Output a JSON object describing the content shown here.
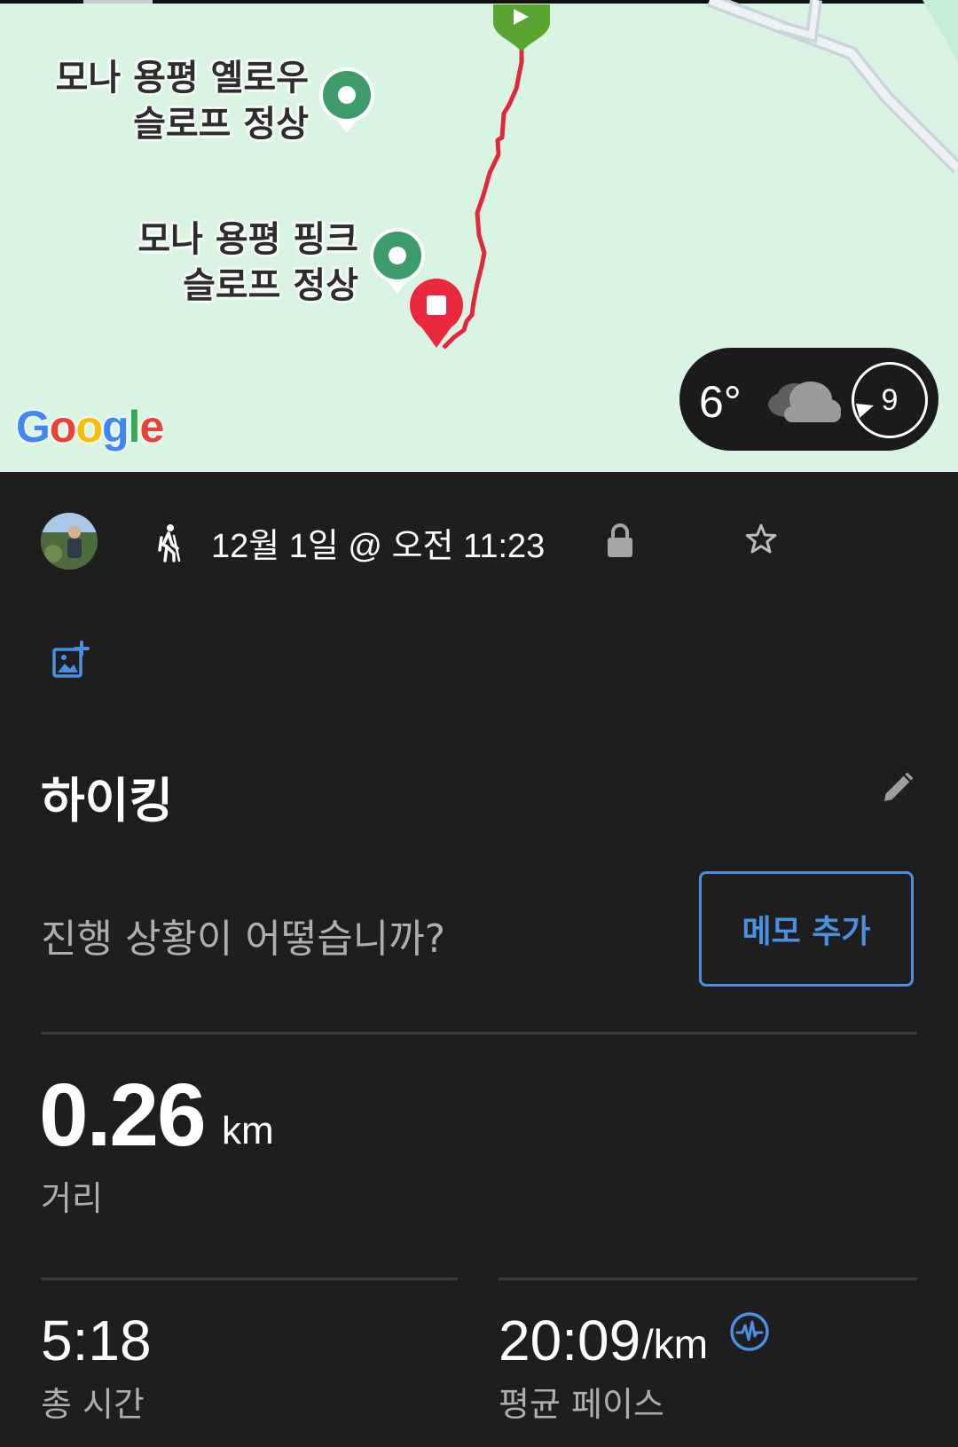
{
  "map": {
    "poi_1": {
      "line1": "모나 용평 옐로우",
      "line2": "슬로프 정상"
    },
    "poi_2": {
      "line1": "모나 용평 핑크",
      "line2": "슬로프 정상"
    },
    "logo_letters": [
      "G",
      "o",
      "o",
      "g",
      "l",
      "e"
    ],
    "logo_colors": [
      "#4285F4",
      "#EA4335",
      "#FBBC05",
      "#4285F4",
      "#34A853",
      "#EA4335"
    ],
    "route_color": "#e0283a",
    "start_color": "#5aa532",
    "end_color": "#e8283c",
    "poi_color": "#3e9c6b"
  },
  "weather": {
    "temperature": "6°",
    "icon": "cloud-icon",
    "wind_speed": "9",
    "wind_icon": "wind-direction-icon"
  },
  "activity": {
    "date_time": "12월 1일 @ 오전 11:23",
    "type_icon": "hiking-icon",
    "privacy_icon": "lock-icon",
    "favorite_icon": "star-icon",
    "photo_icon": "add-photo-icon",
    "title": "하이킹",
    "notes_prompt": "진행 상황이 어떻습니까?",
    "add_note_label": "메모 추가"
  },
  "stats": {
    "distance": {
      "value": "0.26",
      "unit": "km",
      "label": "거리"
    },
    "total_time": {
      "value": "5:18",
      "label": "총 시간"
    },
    "avg_pace": {
      "value": "20:09",
      "unit": "/km",
      "label": "평균 페이스"
    }
  },
  "colors": {
    "accent": "#4a8fe0",
    "background": "#1e1e1f",
    "map_background": "#d9f4e3"
  }
}
